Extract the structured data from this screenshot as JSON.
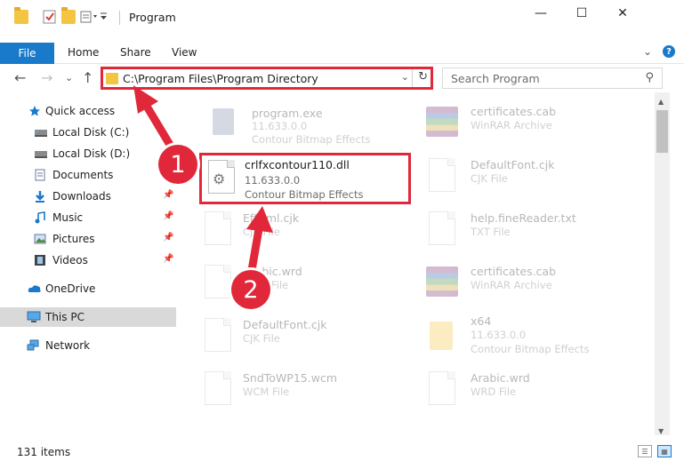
{
  "window": {
    "title": "Program",
    "controls": {
      "minimize": "—",
      "maximize": "☐",
      "close": "✕"
    }
  },
  "ribbon": {
    "file_tab": "File",
    "tabs": [
      "Home",
      "Share",
      "View"
    ],
    "expand": "⌄",
    "help": "?"
  },
  "nav": {
    "back": "←",
    "forward": "→",
    "recent": "⌄",
    "up": "↑",
    "address": "C:\\Program Files\\Program Directory",
    "address_drop": "⌄",
    "refresh": "↻",
    "search_placeholder": "Search Program",
    "search_icon": "⚲"
  },
  "sidebar": {
    "items": [
      {
        "label": "Quick access",
        "icon": "star-icon",
        "pinned": false
      },
      {
        "label": "Local Disk (C:)",
        "icon": "drive-icon",
        "pinned": false
      },
      {
        "label": "Local Disk (D:)",
        "icon": "drive-icon",
        "pinned": false
      },
      {
        "label": "Documents",
        "icon": "documents-icon",
        "pinned": true
      },
      {
        "label": "Downloads",
        "icon": "download-icon",
        "pinned": true
      },
      {
        "label": "Music",
        "icon": "music-icon",
        "pinned": true
      },
      {
        "label": "Pictures",
        "icon": "pictures-icon",
        "pinned": true
      },
      {
        "label": "Videos",
        "icon": "videos-icon",
        "pinned": true
      },
      {
        "label": "OneDrive",
        "icon": "cloud-icon",
        "pinned": false
      },
      {
        "label": "This PC",
        "icon": "monitor-icon",
        "pinned": false,
        "selected": true
      },
      {
        "label": "Network",
        "icon": "network-icon",
        "pinned": false
      }
    ],
    "pin_glyph": "📌"
  },
  "files": [
    {
      "name": "program.exe",
      "line1": "11.633.0.0",
      "line2": "Contour Bitmap Effects",
      "type": "exe"
    },
    {
      "name": "certificates.cab",
      "line1": "WinRAR Archive",
      "line2": "",
      "type": "rar"
    },
    {
      "name": "crlfxcontour110.dll",
      "line1": "11.633.0.0",
      "line2": "Contour Bitmap Effects",
      "type": "dll",
      "highlighted": true
    },
    {
      "name": "DefaultFont.cjk",
      "line1": "CJK File",
      "line2": "",
      "type": "doc"
    },
    {
      "name": "EffNml.cjk",
      "line1": "CJK File",
      "line2": "",
      "type": "doc"
    },
    {
      "name": "help.fineReader.txt",
      "line1": "TXT File",
      "line2": "",
      "type": "doc"
    },
    {
      "name": "Arabic.wrd",
      "line1": "WRD File",
      "line2": "",
      "type": "doc"
    },
    {
      "name": "certificates.cab",
      "line1": "WinRAR Archive",
      "line2": "",
      "type": "rar"
    },
    {
      "name": "DefaultFont.cjk",
      "line1": "CJK File",
      "line2": "",
      "type": "doc"
    },
    {
      "name": "x64",
      "line1": "11.633.0.0",
      "line2": "Contour Bitmap Effects",
      "type": "folder"
    },
    {
      "name": "SndToWP15.wcm",
      "line1": "WCM File",
      "line2": "",
      "type": "doc"
    },
    {
      "name": "Arabic.wrd",
      "line1": "WRD File",
      "line2": "",
      "type": "doc"
    }
  ],
  "annotations": [
    "1",
    "2"
  ],
  "status": {
    "count": "131 items"
  },
  "colors": {
    "accent": "#1979ca",
    "highlight": "#e0283a",
    "selected_bg": "#d9d9d9"
  }
}
